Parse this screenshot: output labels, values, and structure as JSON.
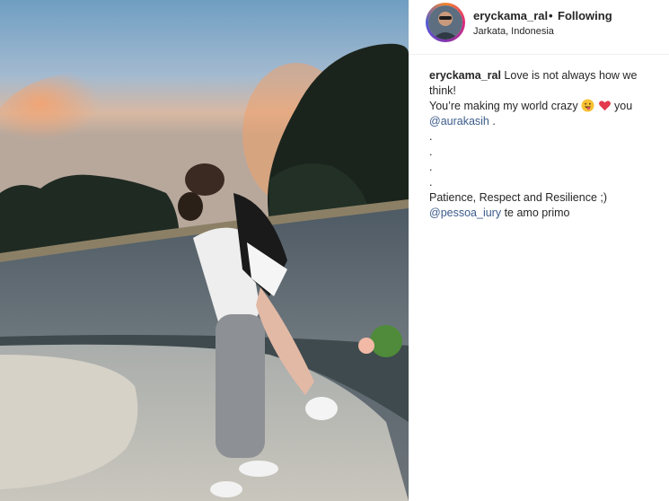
{
  "post": {
    "username": "eryckama_ral",
    "separator": "•",
    "follow_status": "Following",
    "location": "Jarkata, Indonesia"
  },
  "caption": {
    "author": "eryckama_ral",
    "line1_text": "Love is not always how we",
    "line2": "think!",
    "line3_start": "You’re making my world crazy",
    "line3_end": "you",
    "mention1": "@aurakasih",
    "mention1_suffix": " .",
    "dot": ".",
    "line_patience": "Patience, Respect and Resilience ;)",
    "mention2": "@pessoa_iury",
    "mention2_suffix": " te amo primo"
  },
  "colors": {
    "mention": "#3b5b8a",
    "text": "#262626",
    "heart": "#ed4956"
  },
  "icons": [
    "grinning-tongue-emoji-icon",
    "red-heart-emoji-icon"
  ]
}
